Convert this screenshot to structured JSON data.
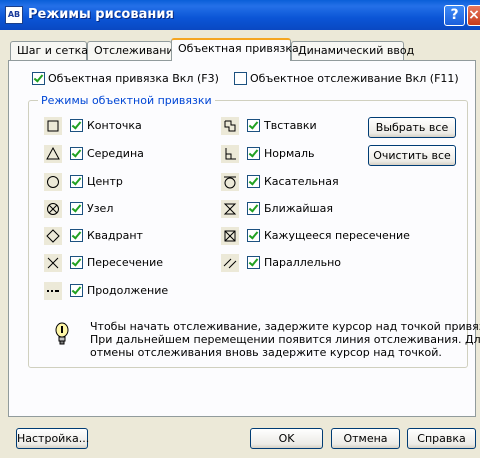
{
  "window": {
    "title": "Режимы рисования",
    "icon_text": "AB",
    "help_glyph": "?",
    "close_glyph": "×"
  },
  "tabs": [
    {
      "label": "Шаг и сетка",
      "active": false
    },
    {
      "label": "Отслеживание",
      "active": false
    },
    {
      "label": "Объектная привязка",
      "active": true
    },
    {
      "label": "Динамический ввод",
      "active": false
    }
  ],
  "osnap_on": {
    "label": "Объектная привязка Вкл (F3)",
    "checked": true
  },
  "otrack_on": {
    "label": "Объектное отслеживание Вкл (F11)",
    "checked": false
  },
  "group": {
    "legend": "Режимы объектной привязки"
  },
  "left_modes": [
    {
      "label": "Конточка",
      "icon": "endpoint-icon",
      "checked": true
    },
    {
      "label": "Середина",
      "icon": "midpoint-icon",
      "checked": true
    },
    {
      "label": "Центр",
      "icon": "center-icon",
      "checked": true
    },
    {
      "label": "Узел",
      "icon": "node-icon",
      "checked": true
    },
    {
      "label": "Квадрант",
      "icon": "quadrant-icon",
      "checked": true
    },
    {
      "label": "Пересечение",
      "icon": "intersection-icon",
      "checked": true
    },
    {
      "label": "Продолжение",
      "icon": "extension-icon",
      "checked": true
    }
  ],
  "right_modes": [
    {
      "label": "Твставки",
      "icon": "insertion-icon",
      "checked": true
    },
    {
      "label": "Нормаль",
      "icon": "perpendicular-icon",
      "checked": true
    },
    {
      "label": "Касательная",
      "icon": "tangent-icon",
      "checked": true
    },
    {
      "label": "Ближайшая",
      "icon": "nearest-icon",
      "checked": true
    },
    {
      "label": "Кажущееся пересечение",
      "icon": "apparent-intersection-icon",
      "checked": true
    },
    {
      "label": "Параллельно",
      "icon": "parallel-icon",
      "checked": true
    }
  ],
  "buttons": {
    "select_all": "Выбрать все",
    "clear_all": "Очистить все",
    "settings": "Настройка...",
    "ok": "OK",
    "cancel": "Отмена",
    "help": "Справка"
  },
  "info": {
    "icon": "lightbulb-icon",
    "lines": [
      "Чтобы начать отслеживание, задержите курсор над точкой привязки.",
      "При дальнейшем перемещении появится линия отслеживания. Для",
      "отмены отслеживания вновь задержите курсор над точкой."
    ]
  }
}
